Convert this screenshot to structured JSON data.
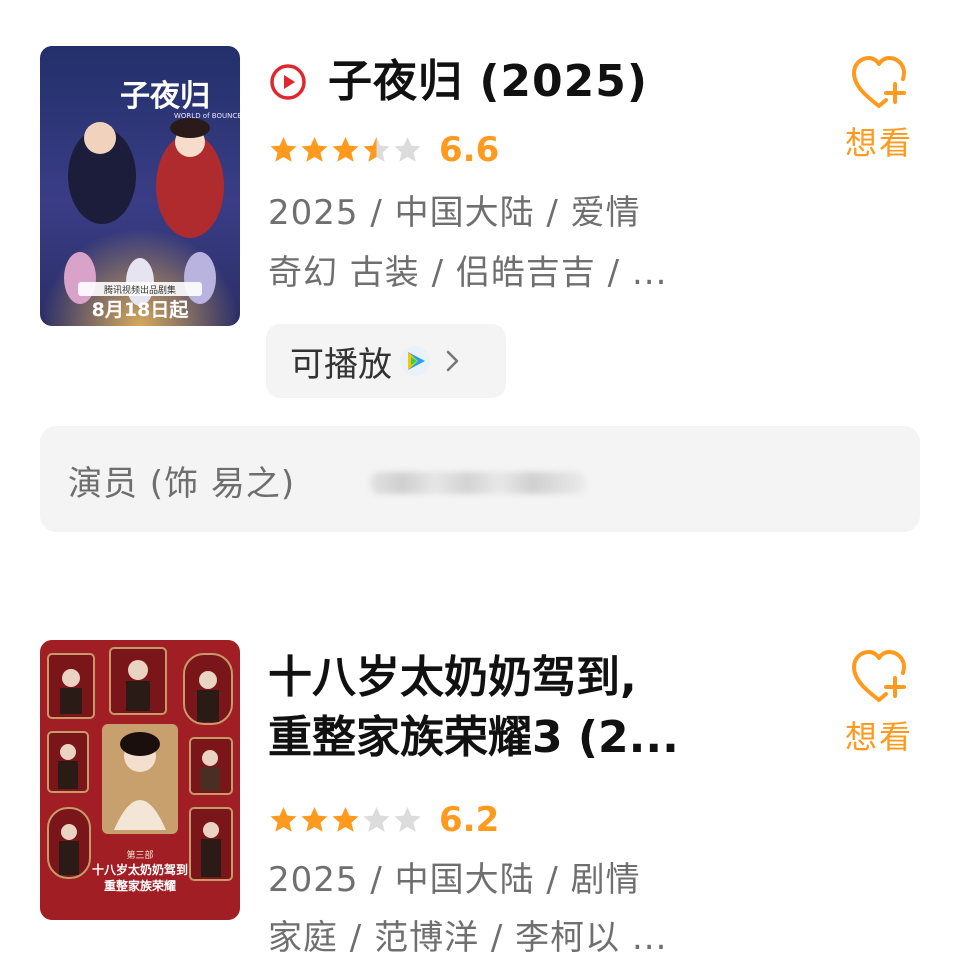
{
  "results": [
    {
      "title": "子夜归 (2025)",
      "has_play_icon": true,
      "rating": 3.5,
      "score": "6.6",
      "meta_line1": "2025 / 中国大陆 / 爱情",
      "meta_line2": "奇幻 古装 / 侣皓吉吉 / ...",
      "playable_label": "可播放",
      "want_label": "想看",
      "cast_label": "演员 (饰 易之)",
      "poster": {
        "title_art": "子夜归",
        "latin": "WORLD of BOUNCE",
        "tagline": "腾讯视频出品剧集",
        "date": "8月18日起",
        "palette": [
          "#1d2a5e",
          "#3b3f8c",
          "#c24a3a",
          "#f2b24a"
        ]
      }
    },
    {
      "title_line1": "十八岁太奶奶驾到,",
      "title_line2": "重整家族荣耀3 (2...",
      "rating": 3,
      "score": "6.2",
      "meta_line1": "2025 / 中国大陆 / 剧情",
      "meta_line2": "家庭 / 范博洋 / 李柯以 ...",
      "want_label": "想看",
      "poster": {
        "season": "第三部",
        "title_art_line1": "十八岁太奶奶驾到",
        "title_art_line2": "重整家族荣耀",
        "palette": [
          "#8e1b1f",
          "#b5272b",
          "#f3e6d6",
          "#2a1b16"
        ]
      }
    }
  ],
  "colors": {
    "accent_orange": "#ff9a1f",
    "meta_gray": "#6f6f6f",
    "play_red": "#e0262f",
    "box_bg": "#f4f4f4"
  },
  "icons": {
    "play": "circle-play-icon",
    "heart_plus": "heart-plus-icon",
    "tencent_video": "tencent-video-icon",
    "chevron": "chevron-right-icon",
    "star": "star-icon"
  }
}
